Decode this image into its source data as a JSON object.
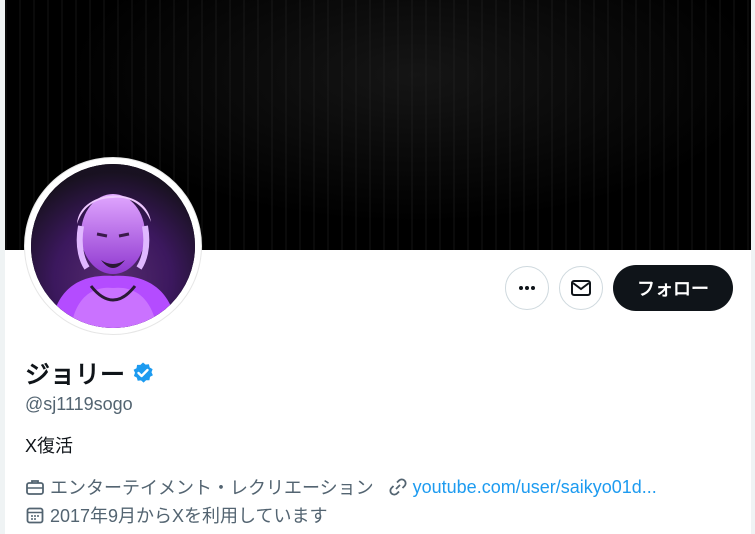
{
  "profile": {
    "display_name": "ジョリー",
    "handle": "@sj1119sogo",
    "bio": "X復活",
    "category": "エンターテイメント・レクリエーション",
    "website": "youtube.com/user/saikyo01d...",
    "joined": "2017年9月からXを利用しています",
    "verified": true
  },
  "actions": {
    "more_icon": "ellipsis-icon",
    "message_icon": "envelope-icon",
    "follow_label": "フォロー"
  },
  "colors": {
    "verified_badge": "#1d9bf0",
    "follow_button": "#0f1419",
    "link": "#1d9bf0",
    "secondary_text": "#536471",
    "avatar_tint": "#a23cff"
  }
}
